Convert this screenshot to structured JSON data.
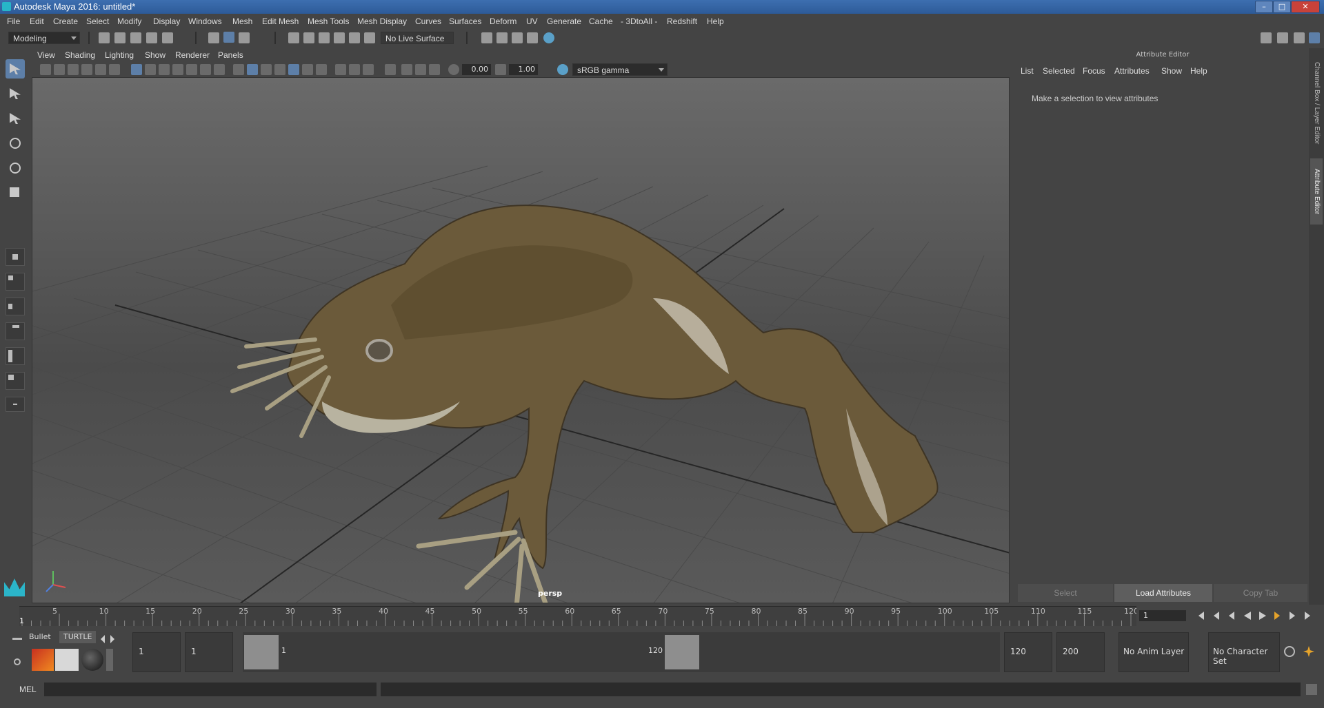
{
  "window": {
    "title": "Autodesk Maya 2016: untitled*"
  },
  "menus": [
    "File",
    "Edit",
    "Create",
    "Select",
    "Modify",
    "Display",
    "Windows",
    "Mesh",
    "Edit Mesh",
    "Mesh Tools",
    "Mesh Display",
    "Curves",
    "Surfaces",
    "Deform",
    "UV",
    "Generate",
    "Cache",
    "- 3DtoAll -",
    "Redshift",
    "Help"
  ],
  "status_line": {
    "mode": "Modeling",
    "live_surface": "No Live Surface"
  },
  "viewport": {
    "menus": [
      "View",
      "Shading",
      "Lighting",
      "Show",
      "Renderer",
      "Panels"
    ],
    "exposure": "0.00",
    "gamma": "1.00",
    "color_space": "sRGB gamma",
    "camera": "persp"
  },
  "attribute_editor": {
    "header": "Attribute Editor",
    "menus": [
      "List",
      "Selected",
      "Focus",
      "Attributes",
      "Show",
      "Help"
    ],
    "message": "Make a selection to view attributes",
    "buttons": [
      "Select",
      "Load Attributes",
      "Copy Tab"
    ],
    "side_tabs": [
      "Channel Box / Layer Editor",
      "Attribute Editor"
    ]
  },
  "timeline": {
    "current_frame": "1",
    "ticks": [
      "5",
      "10",
      "15",
      "20",
      "25",
      "30",
      "35",
      "40",
      "45",
      "50",
      "55",
      "60",
      "65",
      "70",
      "75",
      "80",
      "85",
      "90",
      "95",
      "100",
      "105",
      "110",
      "115",
      "120"
    ],
    "start_label": "1",
    "frame_field": "1"
  },
  "range_slider": {
    "start": "1",
    "playback_start": "1",
    "range_start_label": "1",
    "range_end_label": "120",
    "playback_end": "120",
    "end": "200",
    "anim_layer": "No Anim Layer",
    "character_set": "No Character Set"
  },
  "shelf": {
    "tabs": [
      "Bullet",
      "TURTLE"
    ]
  },
  "command_line": {
    "label": "MEL"
  },
  "colors": {
    "accent": "#5d7fa8",
    "title_bar": "#3d6fb0",
    "panel": "#444444"
  }
}
